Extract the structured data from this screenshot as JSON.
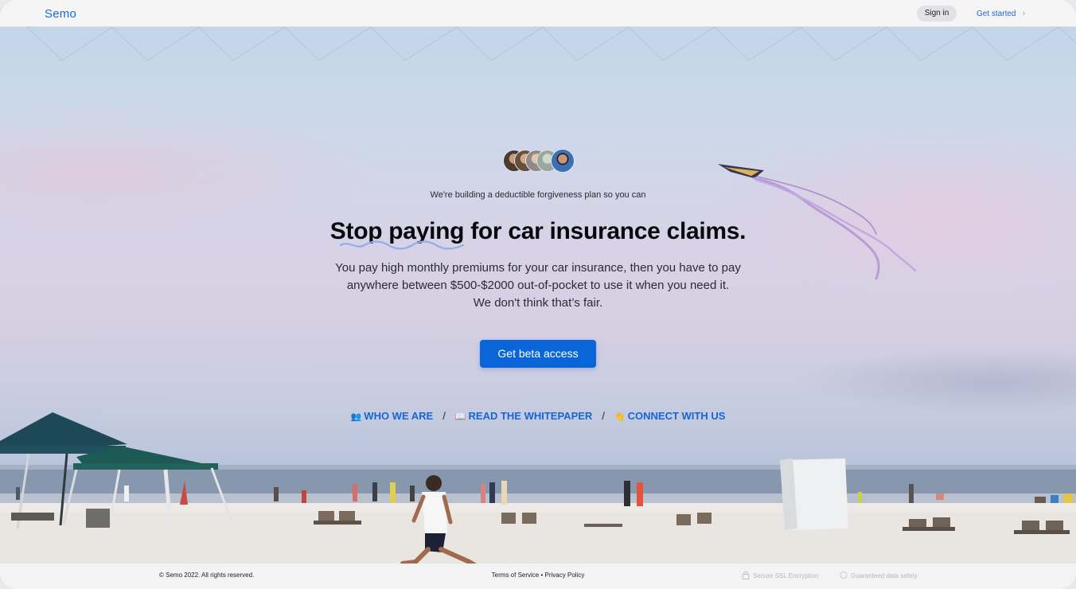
{
  "header": {
    "logo": "Semo",
    "signin_label": "Sign in",
    "getstarted_label": "Get started",
    "chevron": "›"
  },
  "hero": {
    "subline": "We're building a deductible forgiveness plan so you can",
    "headline": "Stop paying for car insurance claims.",
    "paragraph_lines": [
      "You pay high monthly premiums for your car insurance, then you have to pay",
      "anywhere between $500-$2000 out-of-pocket to use it when you need it.",
      "We don't think that’s fair."
    ],
    "cta_label": "Get beta access",
    "links": [
      {
        "icon": "people-icon",
        "emoji": "👥",
        "label": "WHO WE ARE"
      },
      {
        "icon": "book-icon",
        "emoji": "📖",
        "label": "READ THE WHITEPAPER"
      },
      {
        "icon": "wave-hand-icon",
        "emoji": "👋",
        "label": "CONNECT WITH US"
      }
    ],
    "separator": "/"
  },
  "footer": {
    "copyright": "© Semo 2022. All rights reserved.",
    "terms": "Terms of Service",
    "bullet": "•",
    "privacy": "Privacy Policy",
    "ssl": "Secure SSL Encryption",
    "safety": "Guaranteed data safety"
  },
  "colors": {
    "accent": "#0a66d8",
    "link": "#1765d3",
    "logo": "#1f66d6"
  }
}
